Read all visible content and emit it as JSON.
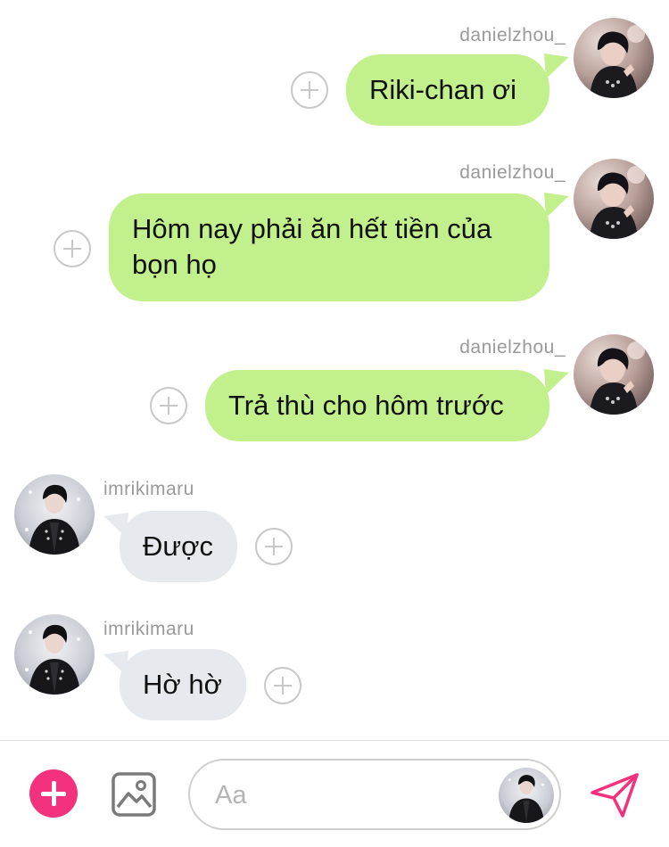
{
  "colors": {
    "outgoing_bubble": "#c2f08d",
    "incoming_bubble": "#e6e9ee",
    "accent": "#f4317d",
    "username_text": "#9a9a9a"
  },
  "messages": [
    {
      "direction": "outgoing",
      "sender": "danielzhou_",
      "text": "Riki-chan ơi"
    },
    {
      "direction": "outgoing",
      "sender": "danielzhou_",
      "text": "Hôm nay phải ăn hết tiền của bọn họ"
    },
    {
      "direction": "outgoing",
      "sender": "danielzhou_",
      "text": "Trả thù cho hôm trước"
    },
    {
      "direction": "incoming",
      "sender": "imrikimaru",
      "text": "Được"
    },
    {
      "direction": "incoming",
      "sender": "imrikimaru",
      "text": "Hờ hờ"
    }
  ],
  "composer": {
    "placeholder": "Aa",
    "add_icon": "plus-icon",
    "image_icon": "image-icon",
    "send_icon": "send-icon"
  }
}
